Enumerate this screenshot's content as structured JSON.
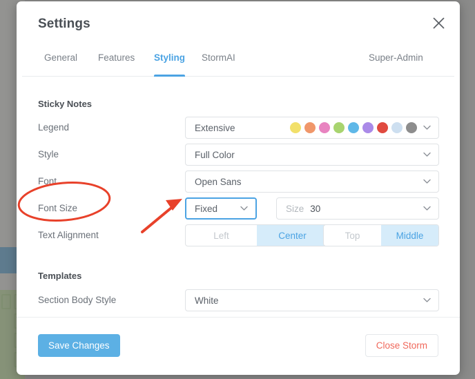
{
  "modal": {
    "title": "Settings",
    "close_icon": "close-icon"
  },
  "tabs": [
    {
      "label": "General",
      "active": false
    },
    {
      "label": "Features",
      "active": false
    },
    {
      "label": "Styling",
      "active": true
    },
    {
      "label": "StormAI",
      "active": false
    }
  ],
  "role_label": "Super-Admin",
  "sections": {
    "sticky_notes": {
      "title": "Sticky Notes",
      "legend": {
        "label": "Legend",
        "value": "Extensive",
        "swatches": [
          "#f2e06a",
          "#f0976a",
          "#e884c0",
          "#a8d46f",
          "#5fb8e8",
          "#aa8ae8",
          "#e04a3f",
          "#cddff0",
          "#8d8d8d"
        ]
      },
      "style": {
        "label": "Style",
        "value": "Full Color"
      },
      "font": {
        "label": "Font",
        "value": "Open Sans"
      },
      "font_size": {
        "label": "Font Size",
        "mode_value": "Fixed",
        "size_placeholder": "Size",
        "size_value": "30"
      },
      "text_alignment": {
        "label": "Text Alignment",
        "horizontal": [
          {
            "label": "Left",
            "selected": false
          },
          {
            "label": "Center",
            "selected": true
          }
        ],
        "vertical": [
          {
            "label": "Top",
            "selected": false
          },
          {
            "label": "Middle",
            "selected": true
          }
        ]
      }
    },
    "templates": {
      "title": "Templates",
      "section_body_style": {
        "label": "Section Body Style",
        "value": "White"
      }
    }
  },
  "footer": {
    "save_label": "Save Changes",
    "close_storm_label": "Close Storm"
  },
  "annotations": {
    "accent_color": "#e8412a",
    "ellipse_target": "Font Size",
    "arrow_target": "Fixed"
  }
}
